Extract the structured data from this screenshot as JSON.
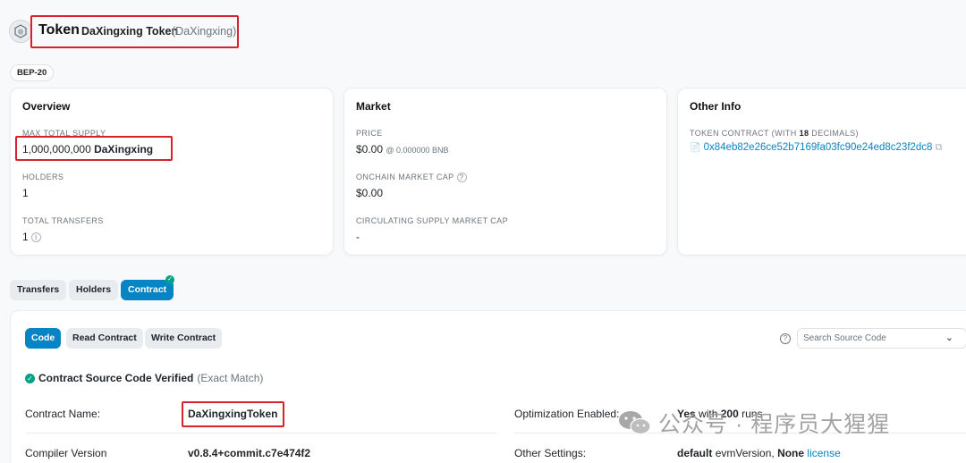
{
  "header": {
    "title": "Token",
    "token_name": "DaXingxing Token",
    "token_symbol": "(DaXingxing)",
    "badge": "BEP-20"
  },
  "overview": {
    "title": "Overview",
    "max_supply_label": "MAX TOTAL SUPPLY",
    "max_supply_amount": "1,000,000,000",
    "max_supply_symbol": "DaXingxing",
    "holders_label": "HOLDERS",
    "holders_value": "1",
    "transfers_label": "TOTAL TRANSFERS",
    "transfers_value": "1"
  },
  "market": {
    "title": "Market",
    "price_label": "PRICE",
    "price_value": "$0.00",
    "price_bnb": "@ 0.000000 BNB",
    "onchain_cap_label": "ONCHAIN MARKET CAP",
    "onchain_cap_value": "$0.00",
    "circ_cap_label": "CIRCULATING SUPPLY MARKET CAP",
    "circ_cap_value": "-"
  },
  "other_info": {
    "title": "Other Info",
    "contract_label_prefix": "TOKEN CONTRACT (WITH",
    "decimals": "18",
    "contract_label_suffix": "DECIMALS)",
    "contract_address": "0x84eb82e26ce52b7169fa03fc90e24ed8c23f2dc8"
  },
  "tabs": {
    "transfers": "Transfers",
    "holders": "Holders",
    "contract": "Contract"
  },
  "contract_panel": {
    "code_btn": "Code",
    "read_btn": "Read Contract",
    "write_btn": "Write Contract",
    "search_placeholder": "Search Source Code",
    "verified_text": "Contract Source Code Verified",
    "exact_match": "(Exact Match)",
    "contract_name_label": "Contract Name:",
    "contract_name_value": "DaXingxingToken",
    "compiler_label": "Compiler Version",
    "compiler_value": "v0.8.4+commit.c7e474f2",
    "optimization_label": "Optimization Enabled:",
    "optimization_yes": "Yes",
    "optimization_with": "with",
    "optimization_runs": "200",
    "optimization_runs_suffix": "runs",
    "other_settings_label": "Other Settings:",
    "settings_default": "default",
    "settings_evm": "evmVersion,",
    "settings_none": "None",
    "settings_license": "license"
  },
  "watermark": {
    "text": "公众号 · 程序员大猩猩"
  },
  "colors": {
    "accent": "#0784c3",
    "verified_green": "#00a186",
    "highlight_red": "#d6222a"
  }
}
